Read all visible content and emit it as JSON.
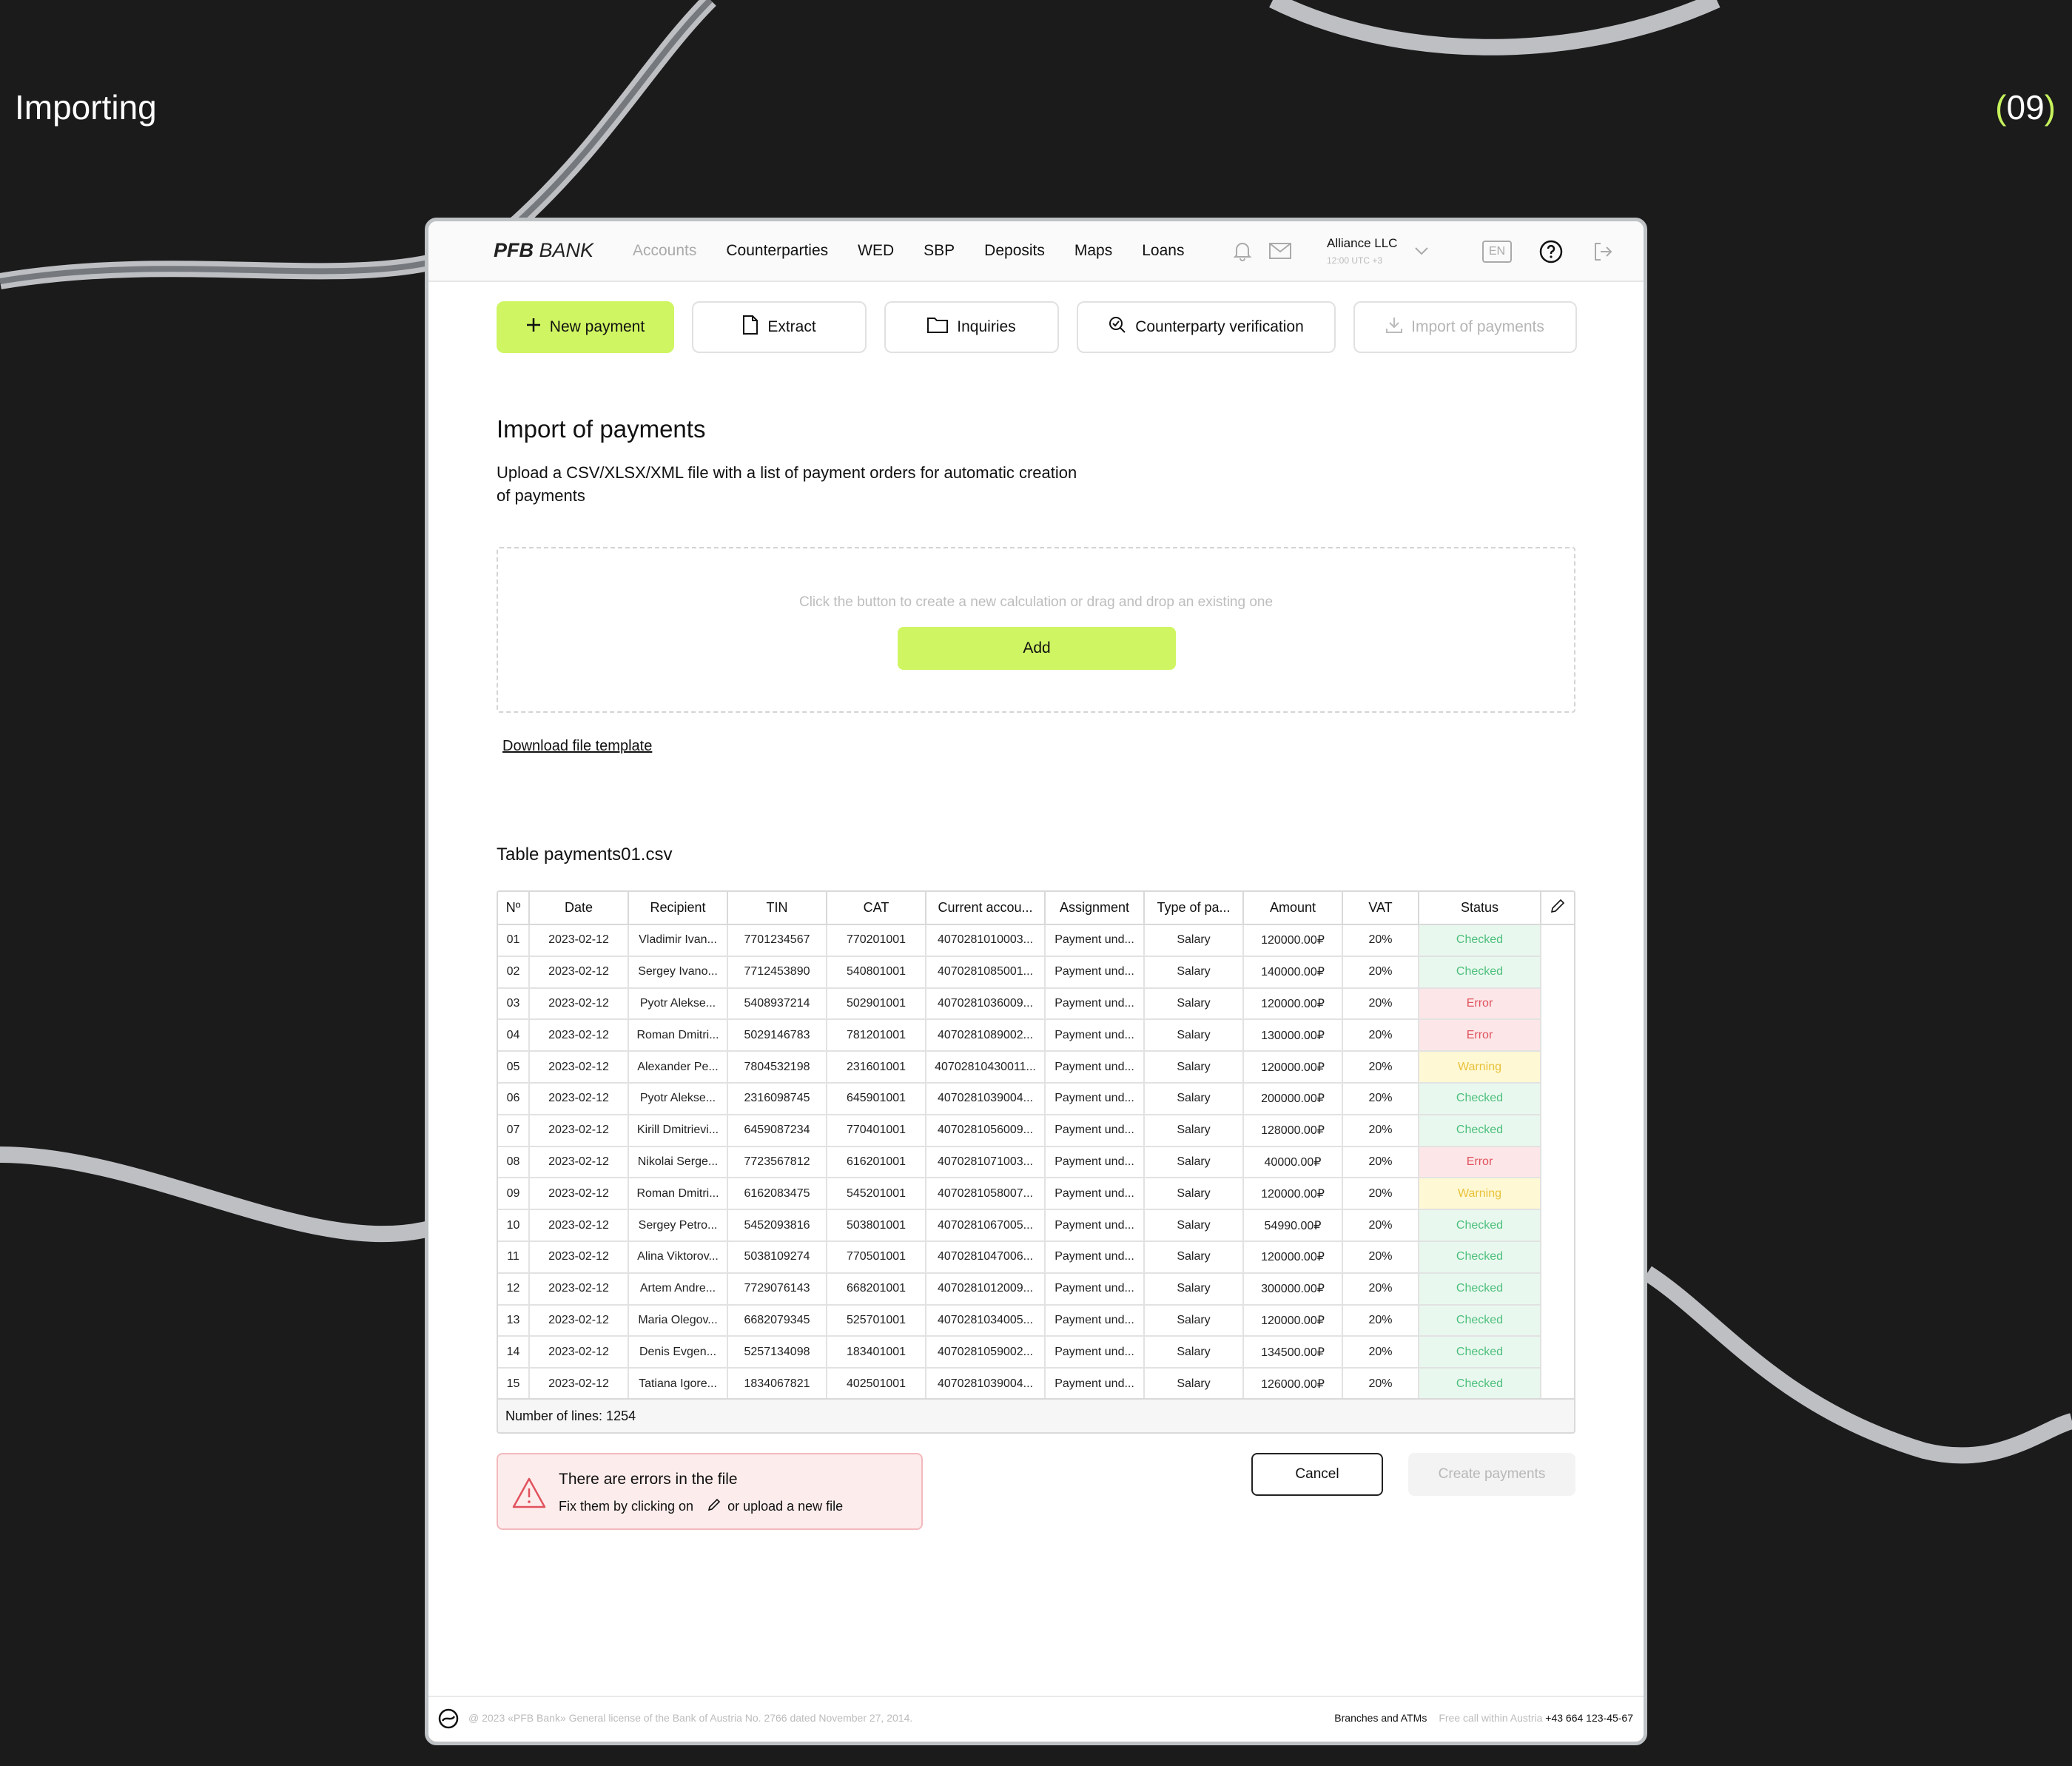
{
  "page": {
    "title": "Importing",
    "number_open": "(",
    "number": "09",
    "number_close": ")"
  },
  "app": {
    "logo_bold": "PFB",
    "logo_rest": " BANK",
    "nav": [
      "Accounts",
      "Counterparties",
      "WED",
      "SBP",
      "Deposits",
      "Maps",
      "Loans"
    ],
    "user_name": "Alliance LLC",
    "user_time": "12:00 UTC +3",
    "lang": "EN"
  },
  "actions": {
    "new_payment": "New payment",
    "extract": "Extract",
    "inquiries": "Inquiries",
    "verification": "Counterparty verification",
    "import": "Import of payments"
  },
  "import": {
    "title": "Import of payments",
    "description": "Upload a CSV/XLSX/XML file with a list of payment orders for automatic creation of payments",
    "drop_hint": "Click the button to create a new calculation or drag and drop an existing one",
    "add_label": "Add",
    "download_label": "Download file template"
  },
  "table": {
    "title": "Table payments01.csv",
    "columns": [
      "Nº",
      "Date",
      "Recipient",
      "TIN",
      "CAT",
      "Current accou...",
      "Assignment",
      "Type of pa...",
      "Amount",
      "VAT",
      "Status"
    ],
    "rows": [
      [
        "01",
        "2023-02-12",
        "Vladimir Ivan...",
        "7701234567",
        "770201001",
        "4070281010003...",
        "Payment und...",
        "Salary",
        "120000.00₽",
        "20%",
        "Checked"
      ],
      [
        "02",
        "2023-02-12",
        "Sergey Ivano...",
        "7712453890",
        "540801001",
        "4070281085001...",
        "Payment und...",
        "Salary",
        "140000.00₽",
        "20%",
        "Checked"
      ],
      [
        "03",
        "2023-02-12",
        "Pyotr Alekse...",
        "5408937214",
        "502901001",
        "4070281036009...",
        "Payment und...",
        "Salary",
        "120000.00₽",
        "20%",
        "Error"
      ],
      [
        "04",
        "2023-02-12",
        "Roman Dmitri...",
        "5029146783",
        "781201001",
        "4070281089002...",
        "Payment und...",
        "Salary",
        "130000.00₽",
        "20%",
        "Error"
      ],
      [
        "05",
        "2023-02-12",
        "Alexander Pe...",
        "7804532198",
        "231601001",
        "40702810430011...",
        "Payment und...",
        "Salary",
        "120000.00₽",
        "20%",
        "Warning"
      ],
      [
        "06",
        "2023-02-12",
        "Pyotr Alekse...",
        "2316098745",
        "645901001",
        "4070281039004...",
        "Payment und...",
        "Salary",
        "200000.00₽",
        "20%",
        "Checked"
      ],
      [
        "07",
        "2023-02-12",
        "Kirill Dmitrievi...",
        "6459087234",
        "770401001",
        "4070281056009...",
        "Payment und...",
        "Salary",
        "128000.00₽",
        "20%",
        "Checked"
      ],
      [
        "08",
        "2023-02-12",
        "Nikolai Serge...",
        "7723567812",
        "616201001",
        "4070281071003...",
        "Payment und...",
        "Salary",
        "40000.00₽",
        "20%",
        "Error"
      ],
      [
        "09",
        "2023-02-12",
        "Roman Dmitri...",
        "6162083475",
        "545201001",
        "4070281058007...",
        "Payment und...",
        "Salary",
        "120000.00₽",
        "20%",
        "Warning"
      ],
      [
        "10",
        "2023-02-12",
        "Sergey Petro...",
        "5452093816",
        "503801001",
        "4070281067005...",
        "Payment und...",
        "Salary",
        "54990.00₽",
        "20%",
        "Checked"
      ],
      [
        "11",
        "2023-02-12",
        "Alina Viktorov...",
        "5038109274",
        "770501001",
        "4070281047006...",
        "Payment und...",
        "Salary",
        "120000.00₽",
        "20%",
        "Checked"
      ],
      [
        "12",
        "2023-02-12",
        "Artem Andre...",
        "7729076143",
        "668201001",
        "4070281012009...",
        "Payment und...",
        "Salary",
        "300000.00₽",
        "20%",
        "Checked"
      ],
      [
        "13",
        "2023-02-12",
        "Maria Olegov...",
        "6682079345",
        "525701001",
        "4070281034005...",
        "Payment und...",
        "Salary",
        "120000.00₽",
        "20%",
        "Checked"
      ],
      [
        "14",
        "2023-02-12",
        "Denis Evgen...",
        "5257134098",
        "183401001",
        "4070281059002...",
        "Payment und...",
        "Salary",
        "134500.00₽",
        "20%",
        "Checked"
      ],
      [
        "15",
        "2023-02-12",
        "Tatiana Igore...",
        "1834067821",
        "402501001",
        "4070281039004...",
        "Payment und...",
        "Salary",
        "126000.00₽",
        "20%",
        "Checked"
      ]
    ],
    "lines_label": "Number of lines: 1254"
  },
  "errors": {
    "title": "There are errors in the file",
    "fix_prefix": "Fix them by clicking on",
    "fix_suffix": "or upload a new file"
  },
  "buttons": {
    "cancel": "Cancel",
    "create": "Create payments"
  },
  "footer": {
    "copyright": "@ 2023 «PFB Bank» General license of the Bank of Austria No. 2766 dated November 27, 2014.",
    "branches": "Branches and ATMs",
    "free_call": "Free call within Austria",
    "phone": "+43 664 123-45-67"
  },
  "colors": {
    "accent": "#cff562",
    "checked": "#4cbf7b",
    "error": "#e0525d",
    "warning": "#e8c23a",
    "background": "#1b1b1b"
  }
}
